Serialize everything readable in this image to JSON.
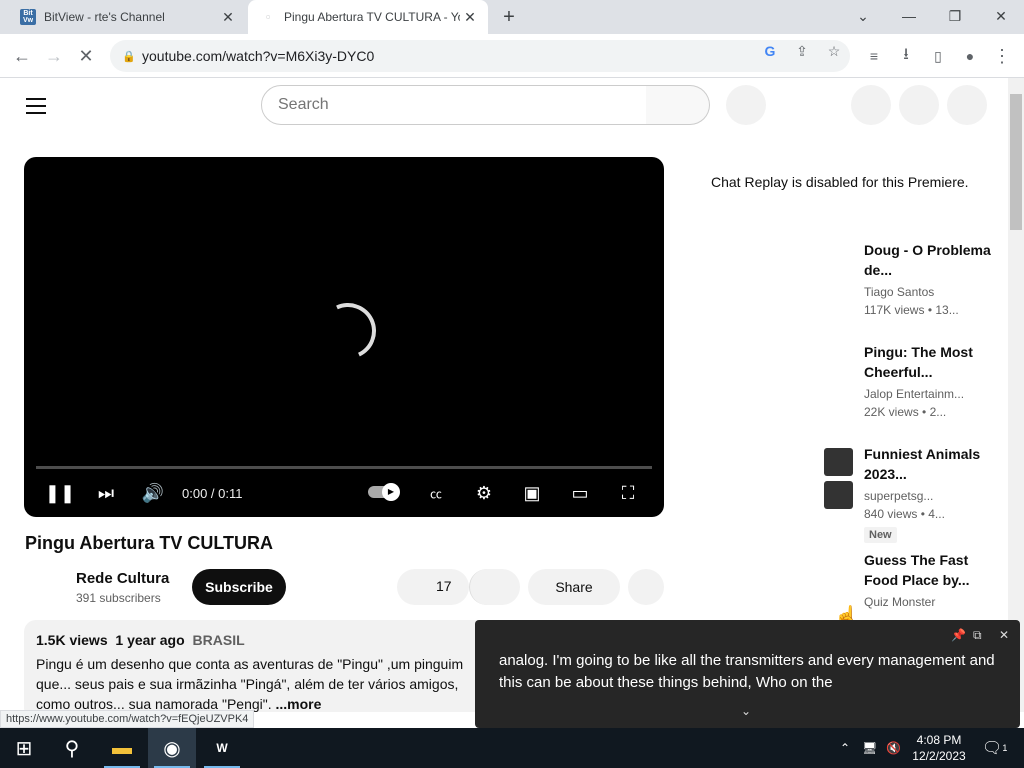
{
  "browser": {
    "tabs": [
      {
        "title": "BitView - rte's Channel",
        "favicon": "bitview-favicon"
      },
      {
        "title": "Pingu Abertura TV CULTURA - Yo",
        "favicon": "youtube-favicon"
      }
    ],
    "url": "youtube.com/watch?v=M6Xi3y-DYC0",
    "status_url": "https://www.youtube.com/watch?v=fEQjeUZVPK4"
  },
  "youtube": {
    "search_placeholder": "Search",
    "player": {
      "time": "0:00 / 0:11",
      "progress": 0
    },
    "video_title": "Pingu Abertura TV CULTURA",
    "channel": {
      "name": "Rede Cultura",
      "subscribers": "391 subscribers"
    },
    "subscribe_label": "Subscribe",
    "like_count": "17",
    "share_label": "Share",
    "description": {
      "views": "1.5K views",
      "age": "1 year ago",
      "country": "BRASIL",
      "text": "Pingu é um desenho que conta as aventuras de \"Pingu\" ,um pinguim que... seus pais e sua irmãzinha \"Pingá\", além de ter vários amigos, como outros... sua namorada \"Pengi\".",
      "more": "...more"
    },
    "chat_replay": "Chat Replay is disabled for this Premiere.",
    "recommendations": [
      {
        "title": "Doug - O Problema de...",
        "channel": "Tiago Santos",
        "views": "117K views",
        "age": "13..."
      },
      {
        "title": "Pingu: The Most Cheerful...",
        "channel": "Jalop Entertainm...",
        "views": "22K views",
        "age": "2..."
      },
      {
        "title": "Funniest Animals 2023...",
        "channel": "superpetsg...",
        "views": "840 views",
        "age": "4...",
        "badge": "New"
      },
      {
        "title": "Guess The Fast Food Place by...",
        "channel": "Quiz Monster",
        "views": "",
        "age": ""
      }
    ]
  },
  "live_caption": {
    "text": "analog. I'm going to be like all the transmitters and every management and this can be about these things behind, Who on the"
  },
  "taskbar": {
    "time": "4:08 PM",
    "date": "12/2/2023",
    "notifications": "1"
  }
}
